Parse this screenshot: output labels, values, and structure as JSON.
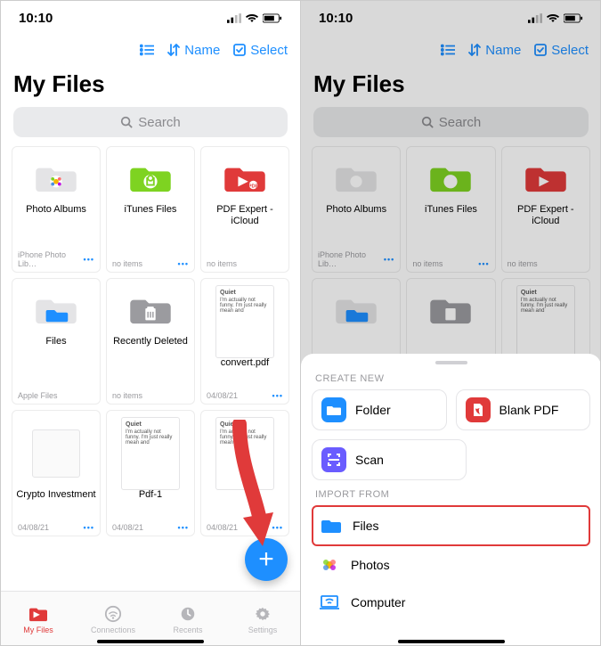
{
  "status": {
    "time": "10:10"
  },
  "toolbar": {
    "sort": "Name",
    "select": "Select"
  },
  "page": {
    "title": "My Files"
  },
  "search": {
    "placeholder": "Search"
  },
  "files": [
    {
      "name": "Photo Albums",
      "meta": "iPhone Photo Lib…"
    },
    {
      "name": "iTunes Files",
      "meta": "no items"
    },
    {
      "name": "PDF Expert - iCloud",
      "meta": "no items"
    },
    {
      "name": "Files",
      "meta": "Apple Files"
    },
    {
      "name": "Recently Deleted",
      "meta": "no items"
    },
    {
      "name": "convert.pdf",
      "meta": "04/08/21",
      "doc": {
        "title": "Quiet",
        "body": "I'm actually not funny. I'm just really mean and"
      }
    },
    {
      "name": "Crypto Investment",
      "meta": "04/08/21"
    },
    {
      "name": "Pdf-1",
      "meta": "04/08/21",
      "doc": {
        "title": "Quiet",
        "body": "I'm actually not funny. I'm just really mean and"
      }
    },
    {
      "name": "",
      "meta": "04/08/21",
      "doc": {
        "title": "Quiet",
        "body": "I'm actually not funny. I'm just really mean and"
      }
    }
  ],
  "tabs": [
    {
      "label": "My Files"
    },
    {
      "label": "Connections"
    },
    {
      "label": "Recents"
    },
    {
      "label": "Settings"
    }
  ],
  "sheet": {
    "create_label": "CREATE NEW",
    "import_label": "IMPORT FROM",
    "create": [
      {
        "label": "Folder"
      },
      {
        "label": "Blank PDF"
      },
      {
        "label": "Scan"
      }
    ],
    "import": [
      {
        "label": "Files"
      },
      {
        "label": "Photos"
      },
      {
        "label": "Computer"
      }
    ]
  }
}
